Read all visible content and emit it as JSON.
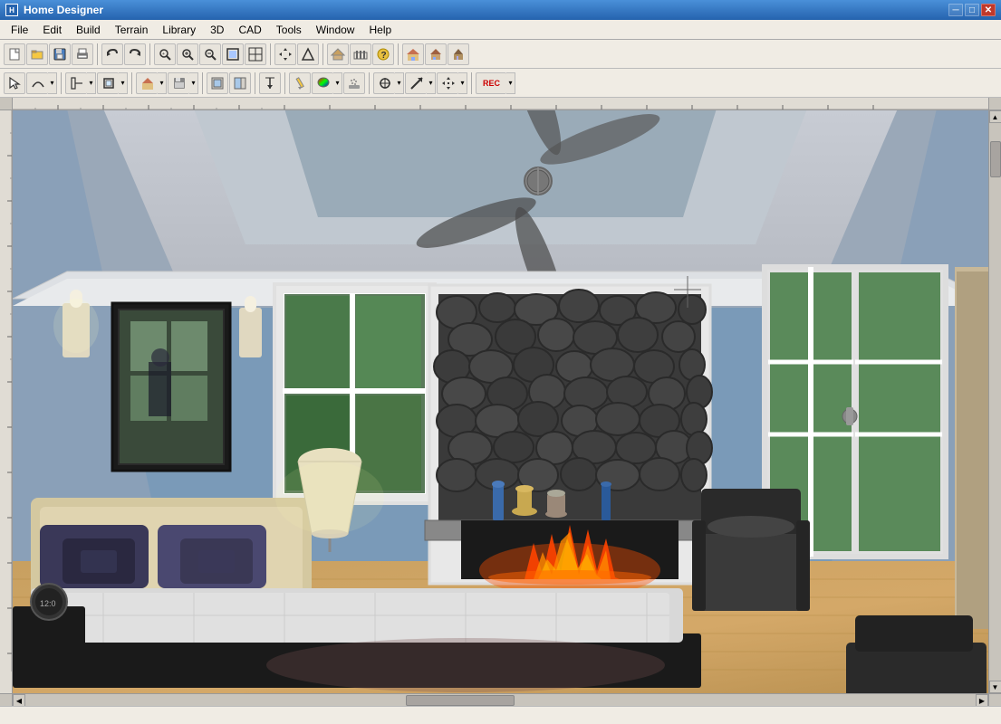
{
  "app": {
    "title": "Home Designer",
    "icon": "H"
  },
  "title_buttons": {
    "minimize": "─",
    "maximize": "□",
    "close": "✕"
  },
  "menu": {
    "items": [
      "File",
      "Edit",
      "Build",
      "Terrain",
      "Library",
      "3D",
      "CAD",
      "Tools",
      "Window",
      "Help"
    ]
  },
  "toolbar1": {
    "buttons": [
      {
        "name": "new",
        "icon": "📄"
      },
      {
        "name": "open",
        "icon": "📂"
      },
      {
        "name": "save",
        "icon": "💾"
      },
      {
        "name": "print",
        "icon": "🖨"
      },
      {
        "name": "undo",
        "icon": "↩"
      },
      {
        "name": "redo",
        "icon": "↪"
      },
      {
        "name": "zoom-in",
        "icon": "🔍"
      },
      {
        "name": "zoom-in2",
        "icon": "⊕"
      },
      {
        "name": "zoom-out",
        "icon": "⊖"
      },
      {
        "name": "zoom-fit",
        "icon": "⊡"
      },
      {
        "name": "zoom-rect",
        "icon": "▢"
      },
      {
        "name": "pan",
        "icon": "✋"
      },
      {
        "name": "arrow-up",
        "icon": "↑"
      },
      {
        "name": "fence",
        "icon": "⬡"
      },
      {
        "name": "question",
        "icon": "?"
      },
      {
        "name": "house",
        "icon": "🏠"
      },
      {
        "name": "house2",
        "icon": "🏡"
      },
      {
        "name": "house3",
        "icon": "🏘"
      }
    ]
  },
  "toolbar2": {
    "buttons": [
      {
        "name": "select",
        "icon": "↖"
      },
      {
        "name": "arc",
        "icon": "◠"
      },
      {
        "name": "line",
        "icon": "—"
      },
      {
        "name": "box",
        "icon": "☐"
      },
      {
        "name": "house-t",
        "icon": "⌂"
      },
      {
        "name": "save2",
        "icon": "💾"
      },
      {
        "name": "shape",
        "icon": "◼"
      },
      {
        "name": "shape2",
        "icon": "◨"
      },
      {
        "name": "transfer",
        "icon": "⇄"
      },
      {
        "name": "pencil",
        "icon": "✏"
      },
      {
        "name": "color",
        "icon": "🎨"
      },
      {
        "name": "spray",
        "icon": "◎"
      },
      {
        "name": "select2",
        "icon": "⊹"
      },
      {
        "name": "arrow",
        "icon": "➤"
      },
      {
        "name": "move",
        "icon": "✥"
      },
      {
        "name": "rec",
        "icon": "REC"
      }
    ]
  },
  "statusbar": {
    "text": ""
  },
  "scene": {
    "description": "3D bedroom interior view with fireplace"
  }
}
